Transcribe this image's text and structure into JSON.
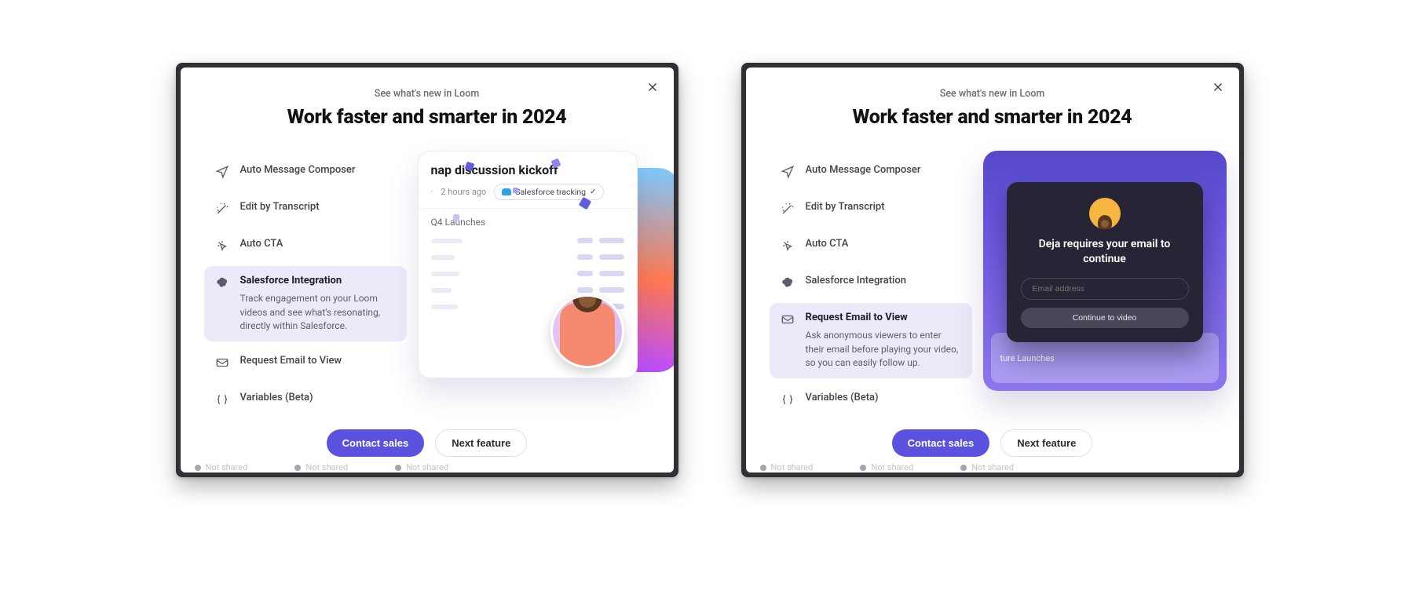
{
  "eyebrow": "See what's new in Loom",
  "title": "Work faster and smarter in 2024",
  "buttons": {
    "contact_sales": "Contact sales",
    "next_feature": "Next feature"
  },
  "features": [
    {
      "key": "auto_message",
      "label": "Auto Message Composer"
    },
    {
      "key": "edit_transcript",
      "label": "Edit by Transcript"
    },
    {
      "key": "auto_cta",
      "label": "Auto CTA"
    },
    {
      "key": "salesforce",
      "label": "Salesforce Integration",
      "desc": "Track engagement on your Loom videos and see what's resonating, directly within Salesforce."
    },
    {
      "key": "request_email",
      "label": "Request Email to View",
      "desc": "Ask anonymous viewers to enter their email before playing your video, so you can easily follow up."
    },
    {
      "key": "variables",
      "label": "Variables (Beta)"
    }
  ],
  "left_modal": {
    "active_key": "salesforce",
    "preview": {
      "title_fragment": "nap discussion kickoff",
      "time": "2 hours ago",
      "badge": "Salesforce tracking",
      "section": "Q4 Launches"
    }
  },
  "right_modal": {
    "active_key": "request_email",
    "preview": {
      "heading": "Deja requires your email to continue",
      "placeholder": "Email address",
      "cta": "Continue to video",
      "bg_text": "ture Launches"
    }
  },
  "bg_text": "Not shared"
}
